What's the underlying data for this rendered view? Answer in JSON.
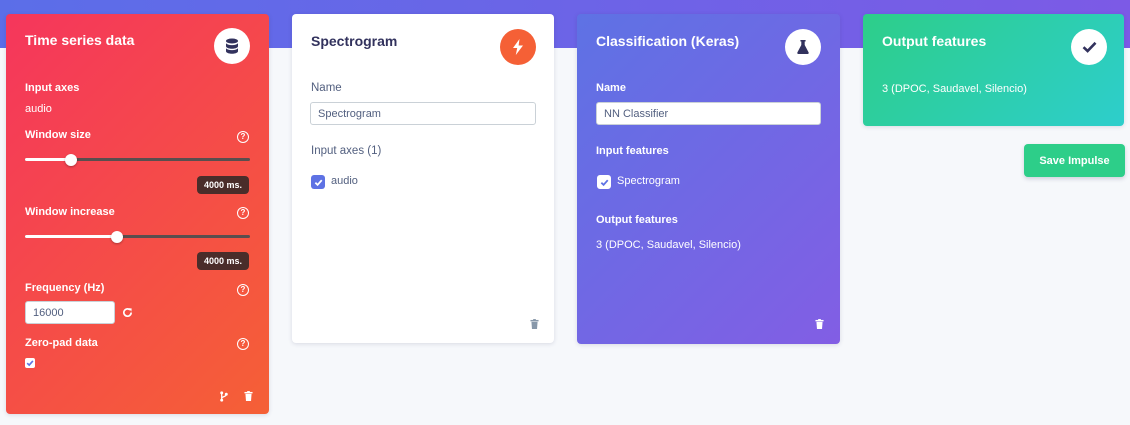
{
  "colors": {
    "top_band": "#5b6ee8",
    "ts_card_gradient": [
      "#f5365c",
      "#f56036"
    ],
    "spectrogram_accent": "#f56036",
    "classification_gradient": [
      "#5e72e4",
      "#825ee4"
    ],
    "output_gradient": [
      "#2dce89",
      "#2dcecc"
    ],
    "save_button": "#2dce89"
  },
  "time_series": {
    "title": "Time series data",
    "icon": "database-icon",
    "input_axes_label": "Input axes",
    "input_axes_value": "audio",
    "window_size_label": "Window size",
    "window_size_value": "4000 ms.",
    "window_size_slider": 0.2,
    "window_increase_label": "Window increase",
    "window_increase_value": "4000 ms.",
    "window_increase_slider": 0.41,
    "frequency_label": "Frequency (Hz)",
    "frequency_value": "16000",
    "zero_pad_label": "Zero-pad data",
    "zero_pad_checked": true
  },
  "spectrogram": {
    "title": "Spectrogram",
    "icon": "lightning-bolt-icon",
    "name_label": "Name",
    "name_value": "Spectrogram",
    "input_axes_label": "Input axes (1)",
    "axis_option": "audio",
    "axis_checked": true
  },
  "classification": {
    "title": "Classification (Keras)",
    "icon": "flask-icon",
    "name_label": "Name",
    "name_value": "NN Classifier",
    "input_features_label": "Input features",
    "input_feature_option": "Spectrogram",
    "input_feature_checked": true,
    "output_features_label": "Output features",
    "output_features_value": "3 (DPOC, Saudavel, Silencio)"
  },
  "output": {
    "title": "Output features",
    "icon": "check-icon",
    "value": "3 (DPOC, Saudavel, Silencio)"
  },
  "save_button_label": "Save Impulse"
}
